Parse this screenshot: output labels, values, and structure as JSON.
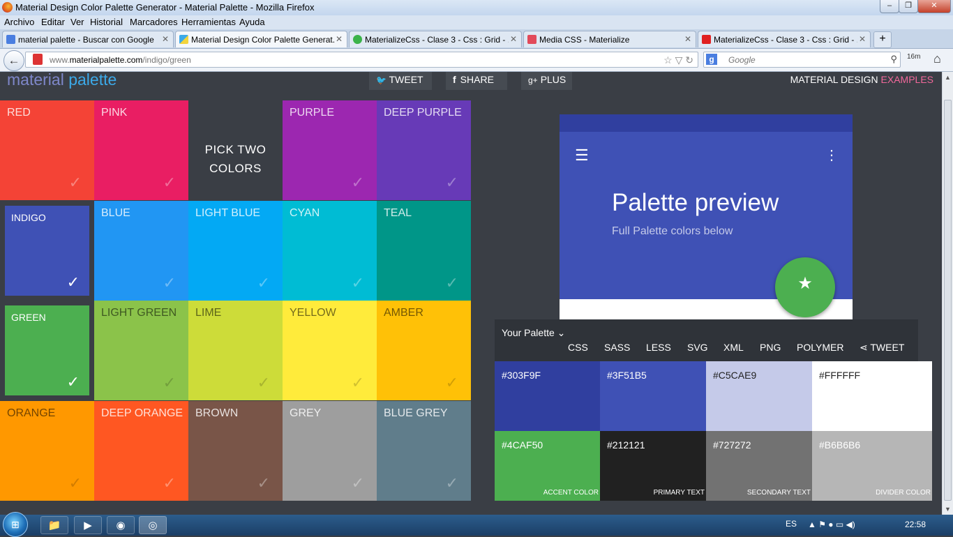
{
  "window": {
    "title": "Material Design Color Palette Generator - Material Palette - Mozilla Firefox",
    "min": "–",
    "max": "❐",
    "close": "✕"
  },
  "menus": [
    "Archivo",
    "Editar",
    "Ver",
    "Historial",
    "Marcadores",
    "Herramientas",
    "Ayuda"
  ],
  "tabs": [
    {
      "label": "material palette - Buscar con Google",
      "icon_color": "#4a7ee0",
      "active": false
    },
    {
      "label": "Material Design Color Palette Generat...",
      "icon_color": "#3ca9e8",
      "active": true
    },
    {
      "label": "MaterializeCss - Clase 3 - Css : Grid - ...",
      "icon_color": "#3bb34a",
      "active": false
    },
    {
      "label": "Media CSS - Materialize",
      "icon_color": "#e24a5a",
      "active": false
    },
    {
      "label": "MaterializeCss - Clase 3 - Css : Grid - ...",
      "icon_color": "#e02020",
      "active": false
    }
  ],
  "tab_close": "✕",
  "newtab": "+",
  "nav": {
    "back": "←",
    "url_prefix": "www.",
    "url_host": "materialpalette.com",
    "url_path": "/indigo/green",
    "url_icons": "☆ ▽ ↻",
    "search_placeholder": "Google",
    "search_engine": "g",
    "search_icon": "⚲",
    "download": "16m",
    "home": "⌂"
  },
  "header": {
    "brand1": "material",
    "brand2": "palette",
    "tweet": "TWEET",
    "share": "SHARE",
    "plus": "PLUS",
    "examples_a": "MATERIAL DESIGN",
    "examples_b": "EXAMPLES",
    "tweet_icon": "🐦",
    "share_icon": "f",
    "plus_icon": "g+"
  },
  "tiles": [
    {
      "name": "RED",
      "color": "#f44336",
      "dark": false,
      "selected": false
    },
    {
      "name": "PINK",
      "color": "#e91e63",
      "dark": false,
      "selected": false
    },
    {
      "name": "",
      "color": "#3a3e45",
      "dark": false,
      "selected": false,
      "hidden": true
    },
    {
      "name": "PURPLE",
      "color": "#9c27b0",
      "dark": false,
      "selected": false
    },
    {
      "name": "DEEP PURPLE",
      "color": "#673ab7",
      "dark": false,
      "selected": false
    },
    {
      "name": "INDIGO",
      "color": "#3f51b5",
      "dark": false,
      "selected": true
    },
    {
      "name": "BLUE",
      "color": "#2196f3",
      "dark": false,
      "selected": false
    },
    {
      "name": "LIGHT BLUE",
      "color": "#03a9f4",
      "dark": false,
      "selected": false
    },
    {
      "name": "CYAN",
      "color": "#00bcd4",
      "dark": false,
      "selected": false
    },
    {
      "name": "TEAL",
      "color": "#009688",
      "dark": false,
      "selected": false
    },
    {
      "name": "GREEN",
      "color": "#4caf50",
      "dark": false,
      "selected": true
    },
    {
      "name": "LIGHT GREEN",
      "color": "#8bc34a",
      "dark": true,
      "selected": false
    },
    {
      "name": "LIME",
      "color": "#cddc39",
      "dark": true,
      "selected": false
    },
    {
      "name": "YELLOW",
      "color": "#ffeb3b",
      "dark": true,
      "selected": false
    },
    {
      "name": "AMBER",
      "color": "#ffc107",
      "dark": true,
      "selected": false
    },
    {
      "name": "ORANGE",
      "color": "#ff9800",
      "dark": true,
      "selected": false
    },
    {
      "name": "DEEP ORANGE",
      "color": "#ff5722",
      "dark": false,
      "selected": false
    },
    {
      "name": "BROWN",
      "color": "#795548",
      "dark": false,
      "selected": false
    },
    {
      "name": "GREY",
      "color": "#9e9e9e",
      "dark": false,
      "selected": false
    },
    {
      "name": "BLUE GREY",
      "color": "#607d8b",
      "dark": false,
      "selected": false
    }
  ],
  "check": "✓",
  "pick": {
    "line1": "PICK TWO",
    "line2": "COLORS"
  },
  "preview": {
    "menu_icon": "☰",
    "more_icon": "⋮",
    "title": "Palette preview",
    "subtitle": "Full Palette colors below",
    "fab_icon": "★"
  },
  "palette": {
    "title": "Your Palette",
    "chevron": "⌄",
    "formats": [
      "CSS",
      "SASS",
      "LESS",
      "SVG",
      "XML",
      "PNG",
      "POLYMER"
    ],
    "tweet": "TWEET",
    "share_icon": "⋖",
    "swatches": [
      {
        "hex": "#303F9F",
        "color": "#303f9f",
        "text": "#fff",
        "label": ""
      },
      {
        "hex": "#3F51B5",
        "color": "#3f51b5",
        "text": "#fff",
        "label": ""
      },
      {
        "hex": "#C5CAE9",
        "color": "#c5cae9",
        "text": "#222",
        "label": ""
      },
      {
        "hex": "#FFFFFF",
        "color": "#ffffff",
        "text": "#222",
        "label": ""
      },
      {
        "hex": "#4CAF50",
        "color": "#4caf50",
        "text": "#fff",
        "label": "ACCENT COLOR"
      },
      {
        "hex": "#212121",
        "color": "#212121",
        "text": "#fff",
        "label": "PRIMARY TEXT"
      },
      {
        "hex": "#727272",
        "color": "#727272",
        "text": "#fff",
        "label": "SECONDARY TEXT"
      },
      {
        "hex": "#B6B6B6",
        "color": "#b6b6b6",
        "text": "#fff",
        "label": "DIVIDER COLOR"
      }
    ]
  },
  "scroll": {
    "up": "▲",
    "down": "▼"
  },
  "taskbar": {
    "start": "⊞",
    "apps": [
      "📁",
      "▶",
      "◉",
      "◎"
    ],
    "lang": "ES",
    "time": "22:58",
    "tray_icons": "▲ ⚑ ● ▭ ◀)"
  }
}
